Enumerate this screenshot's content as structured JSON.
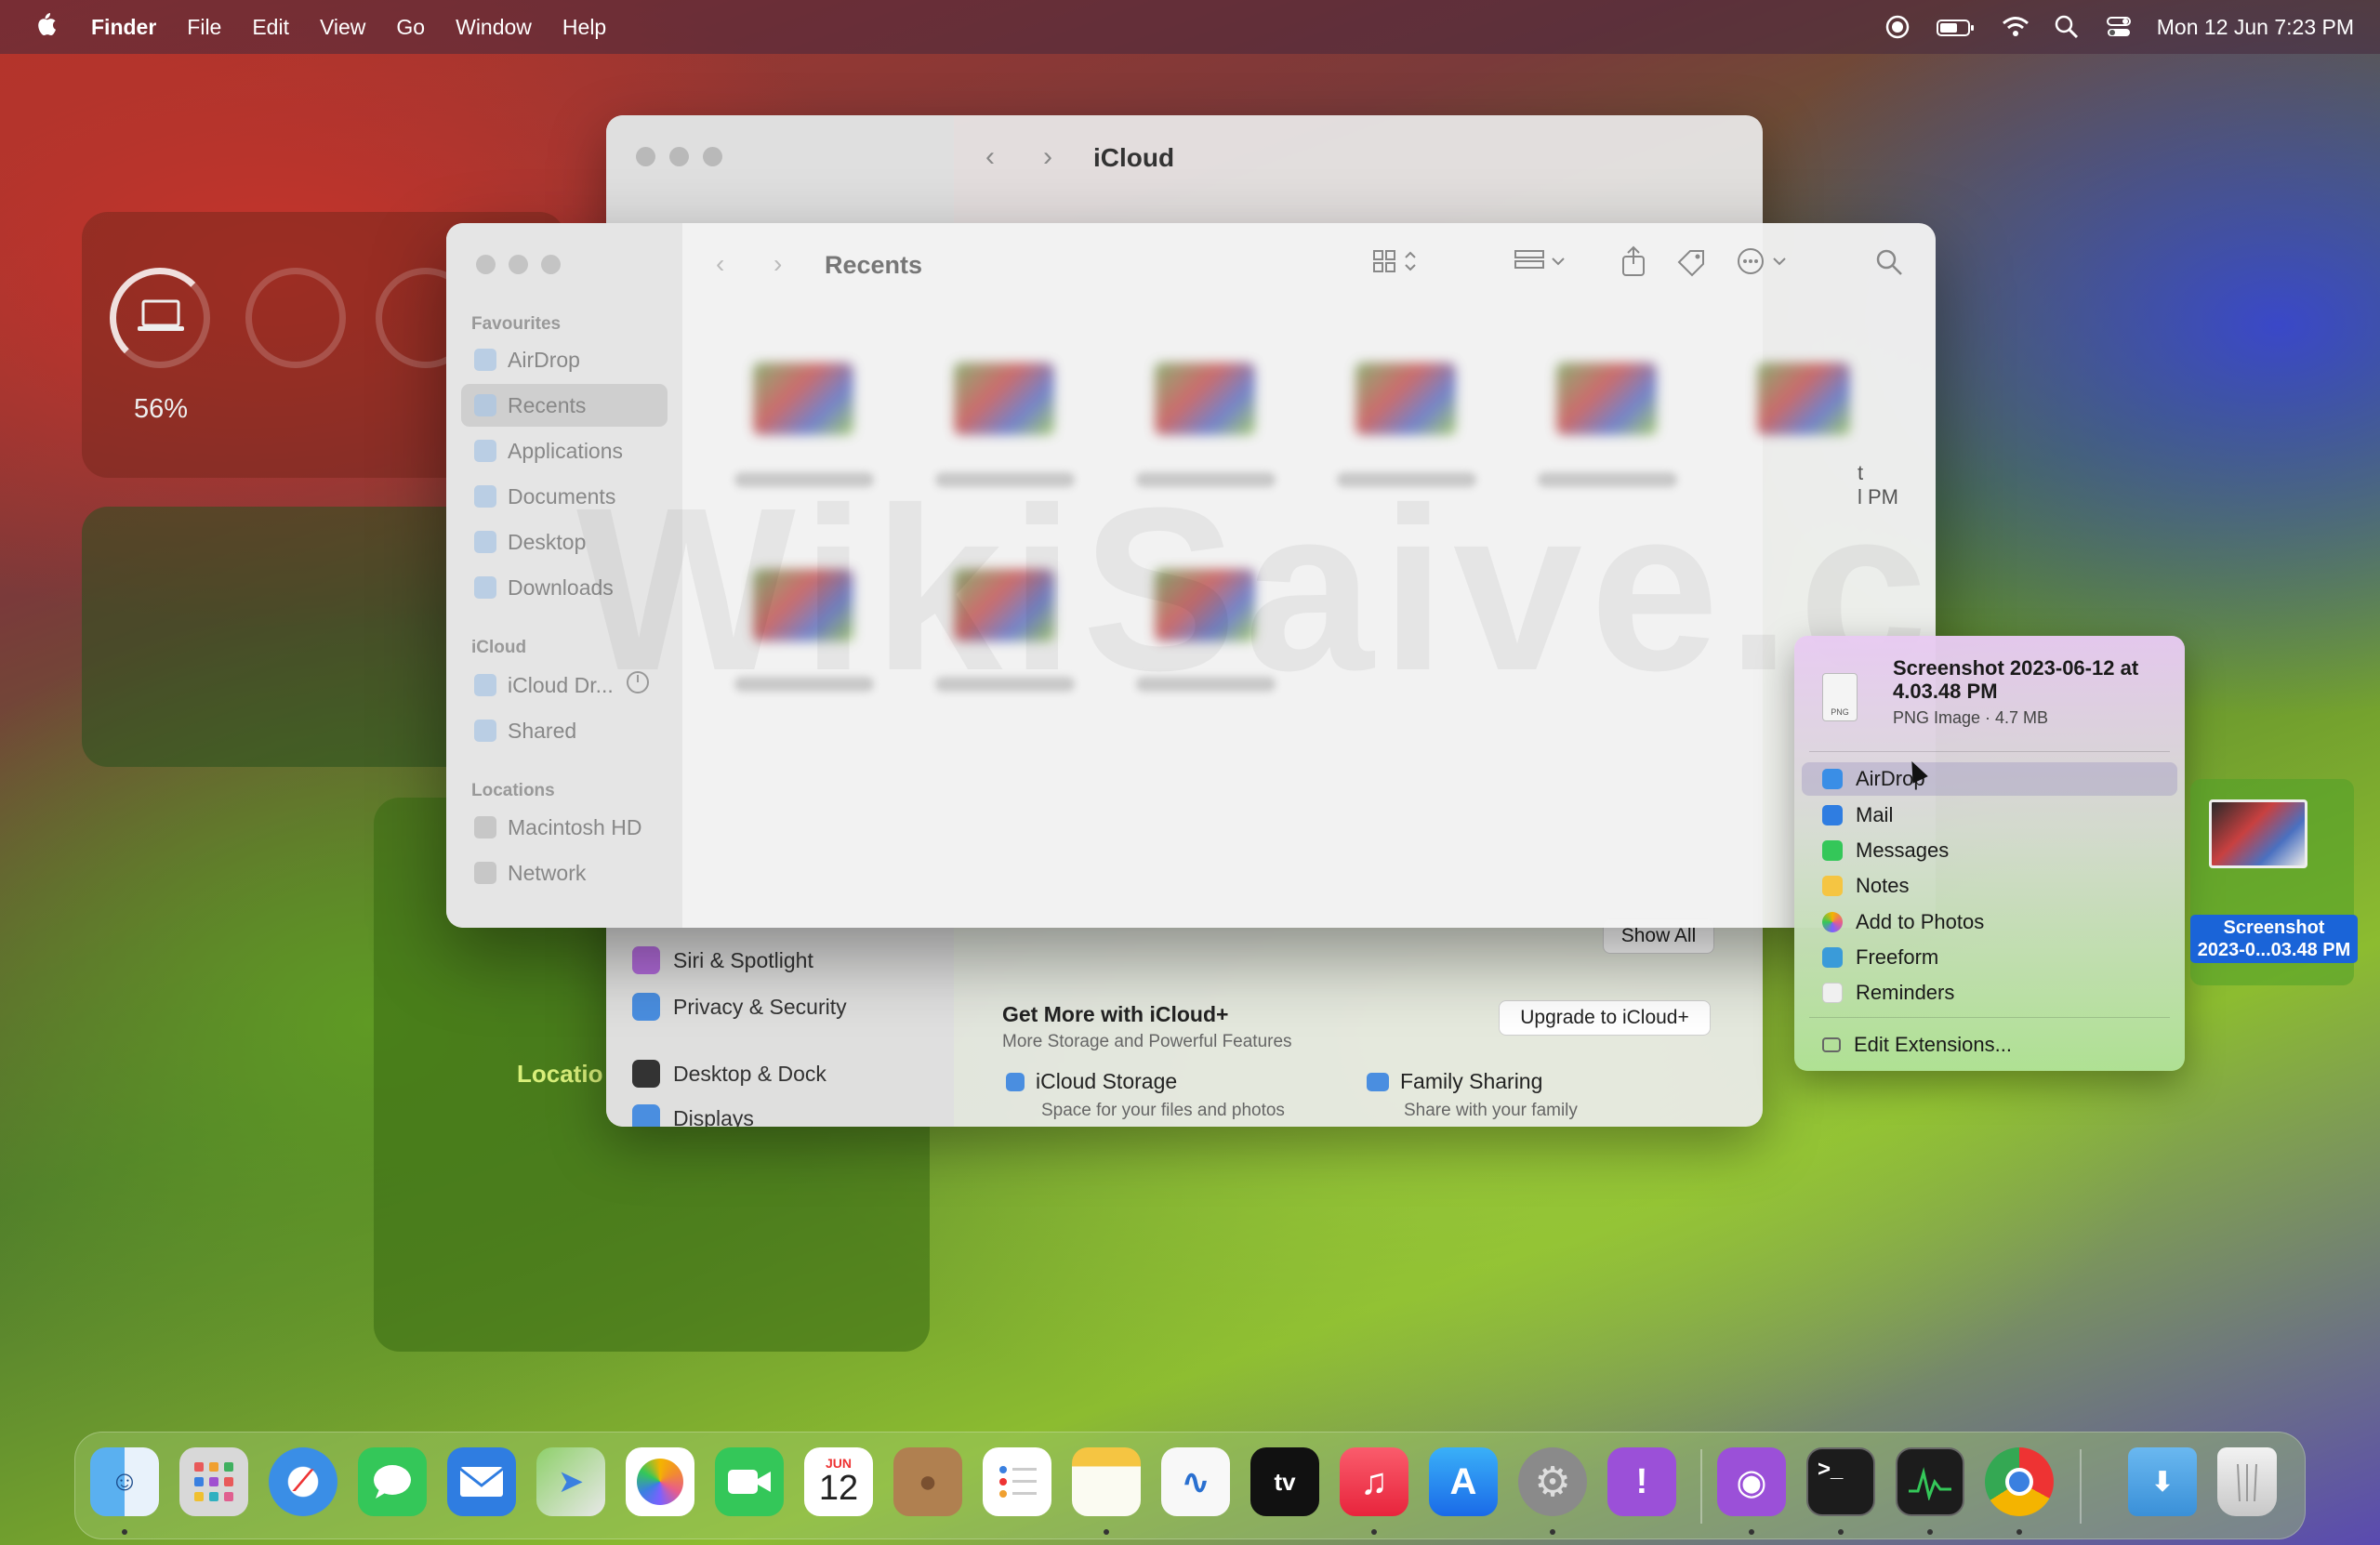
{
  "menubar": {
    "apple": "",
    "app": "Finder",
    "items": [
      "File",
      "Edit",
      "View",
      "Go",
      "Window",
      "Help"
    ],
    "clock": "Mon 12 Jun  7:23 PM"
  },
  "settings_window": {
    "title": "iCloud",
    "sidebar_items": [
      "Siri & Spotlight",
      "Privacy & Security",
      "Desktop & Dock",
      "Displays"
    ],
    "show_all": "Show All",
    "get_more_title": "Get More with iCloud+",
    "get_more_sub": "More Storage and Powerful Features",
    "upgrade": "Upgrade to iCloud+",
    "features": [
      {
        "title": "iCloud Storage",
        "sub": "Space for your files and photos"
      },
      {
        "title": "Family Sharing",
        "sub": "Share with your family"
      }
    ]
  },
  "widgets": {
    "battery_percent": "56%",
    "battery_level": 0.56,
    "map_label": "Locatio"
  },
  "finder": {
    "title": "Recents",
    "sections": {
      "favourites": "Favourites",
      "icloud": "iCloud",
      "locations": "Locations"
    },
    "favourites": [
      "AirDrop",
      "Recents",
      "Applications",
      "Documents",
      "Desktop",
      "Downloads"
    ],
    "icloud": [
      "iCloud Dr...",
      "Shared"
    ],
    "locations": [
      "Macintosh HD",
      "Network"
    ],
    "selected": "Recents",
    "fragment_1": "t",
    "fragment_2": "l PM"
  },
  "share_menu": {
    "file_name": "Screenshot 2023-06-12 at 4.03.48 PM",
    "file_meta": "PNG Image · 4.7 MB",
    "items": [
      {
        "label": "AirDrop",
        "color": "#3a8ee6"
      },
      {
        "label": "Mail",
        "color": "#2f7de1"
      },
      {
        "label": "Messages",
        "color": "#34c759"
      },
      {
        "label": "Notes",
        "color": "#f5c542"
      },
      {
        "label": "Add to Photos",
        "color": "#e85d8a"
      },
      {
        "label": "Freeform",
        "color": "#3a9bd9"
      },
      {
        "label": "Reminders",
        "color": "#f0f0f0"
      }
    ],
    "highlighted": "AirDrop",
    "edit_extensions": "Edit Extensions..."
  },
  "desktop_file": {
    "label_line1": "Screenshot",
    "label_line2": "2023-0...03.48 PM"
  },
  "dock": {
    "apps": [
      "Finder",
      "Launchpad",
      "Safari",
      "Messages",
      "Mail",
      "Maps",
      "Photos",
      "FaceTime",
      "Calendar",
      "Contacts",
      "Reminders",
      "Notes",
      "Freeform",
      "TV",
      "Music",
      "App Store",
      "System Settings",
      "Feedback Assistant",
      "Podcasts",
      "Terminal",
      "Activity Monitor",
      "Chrome",
      "Downloads",
      "Trash"
    ],
    "calendar_month": "JUN",
    "calendar_day": "12",
    "tv_label": "tv"
  }
}
